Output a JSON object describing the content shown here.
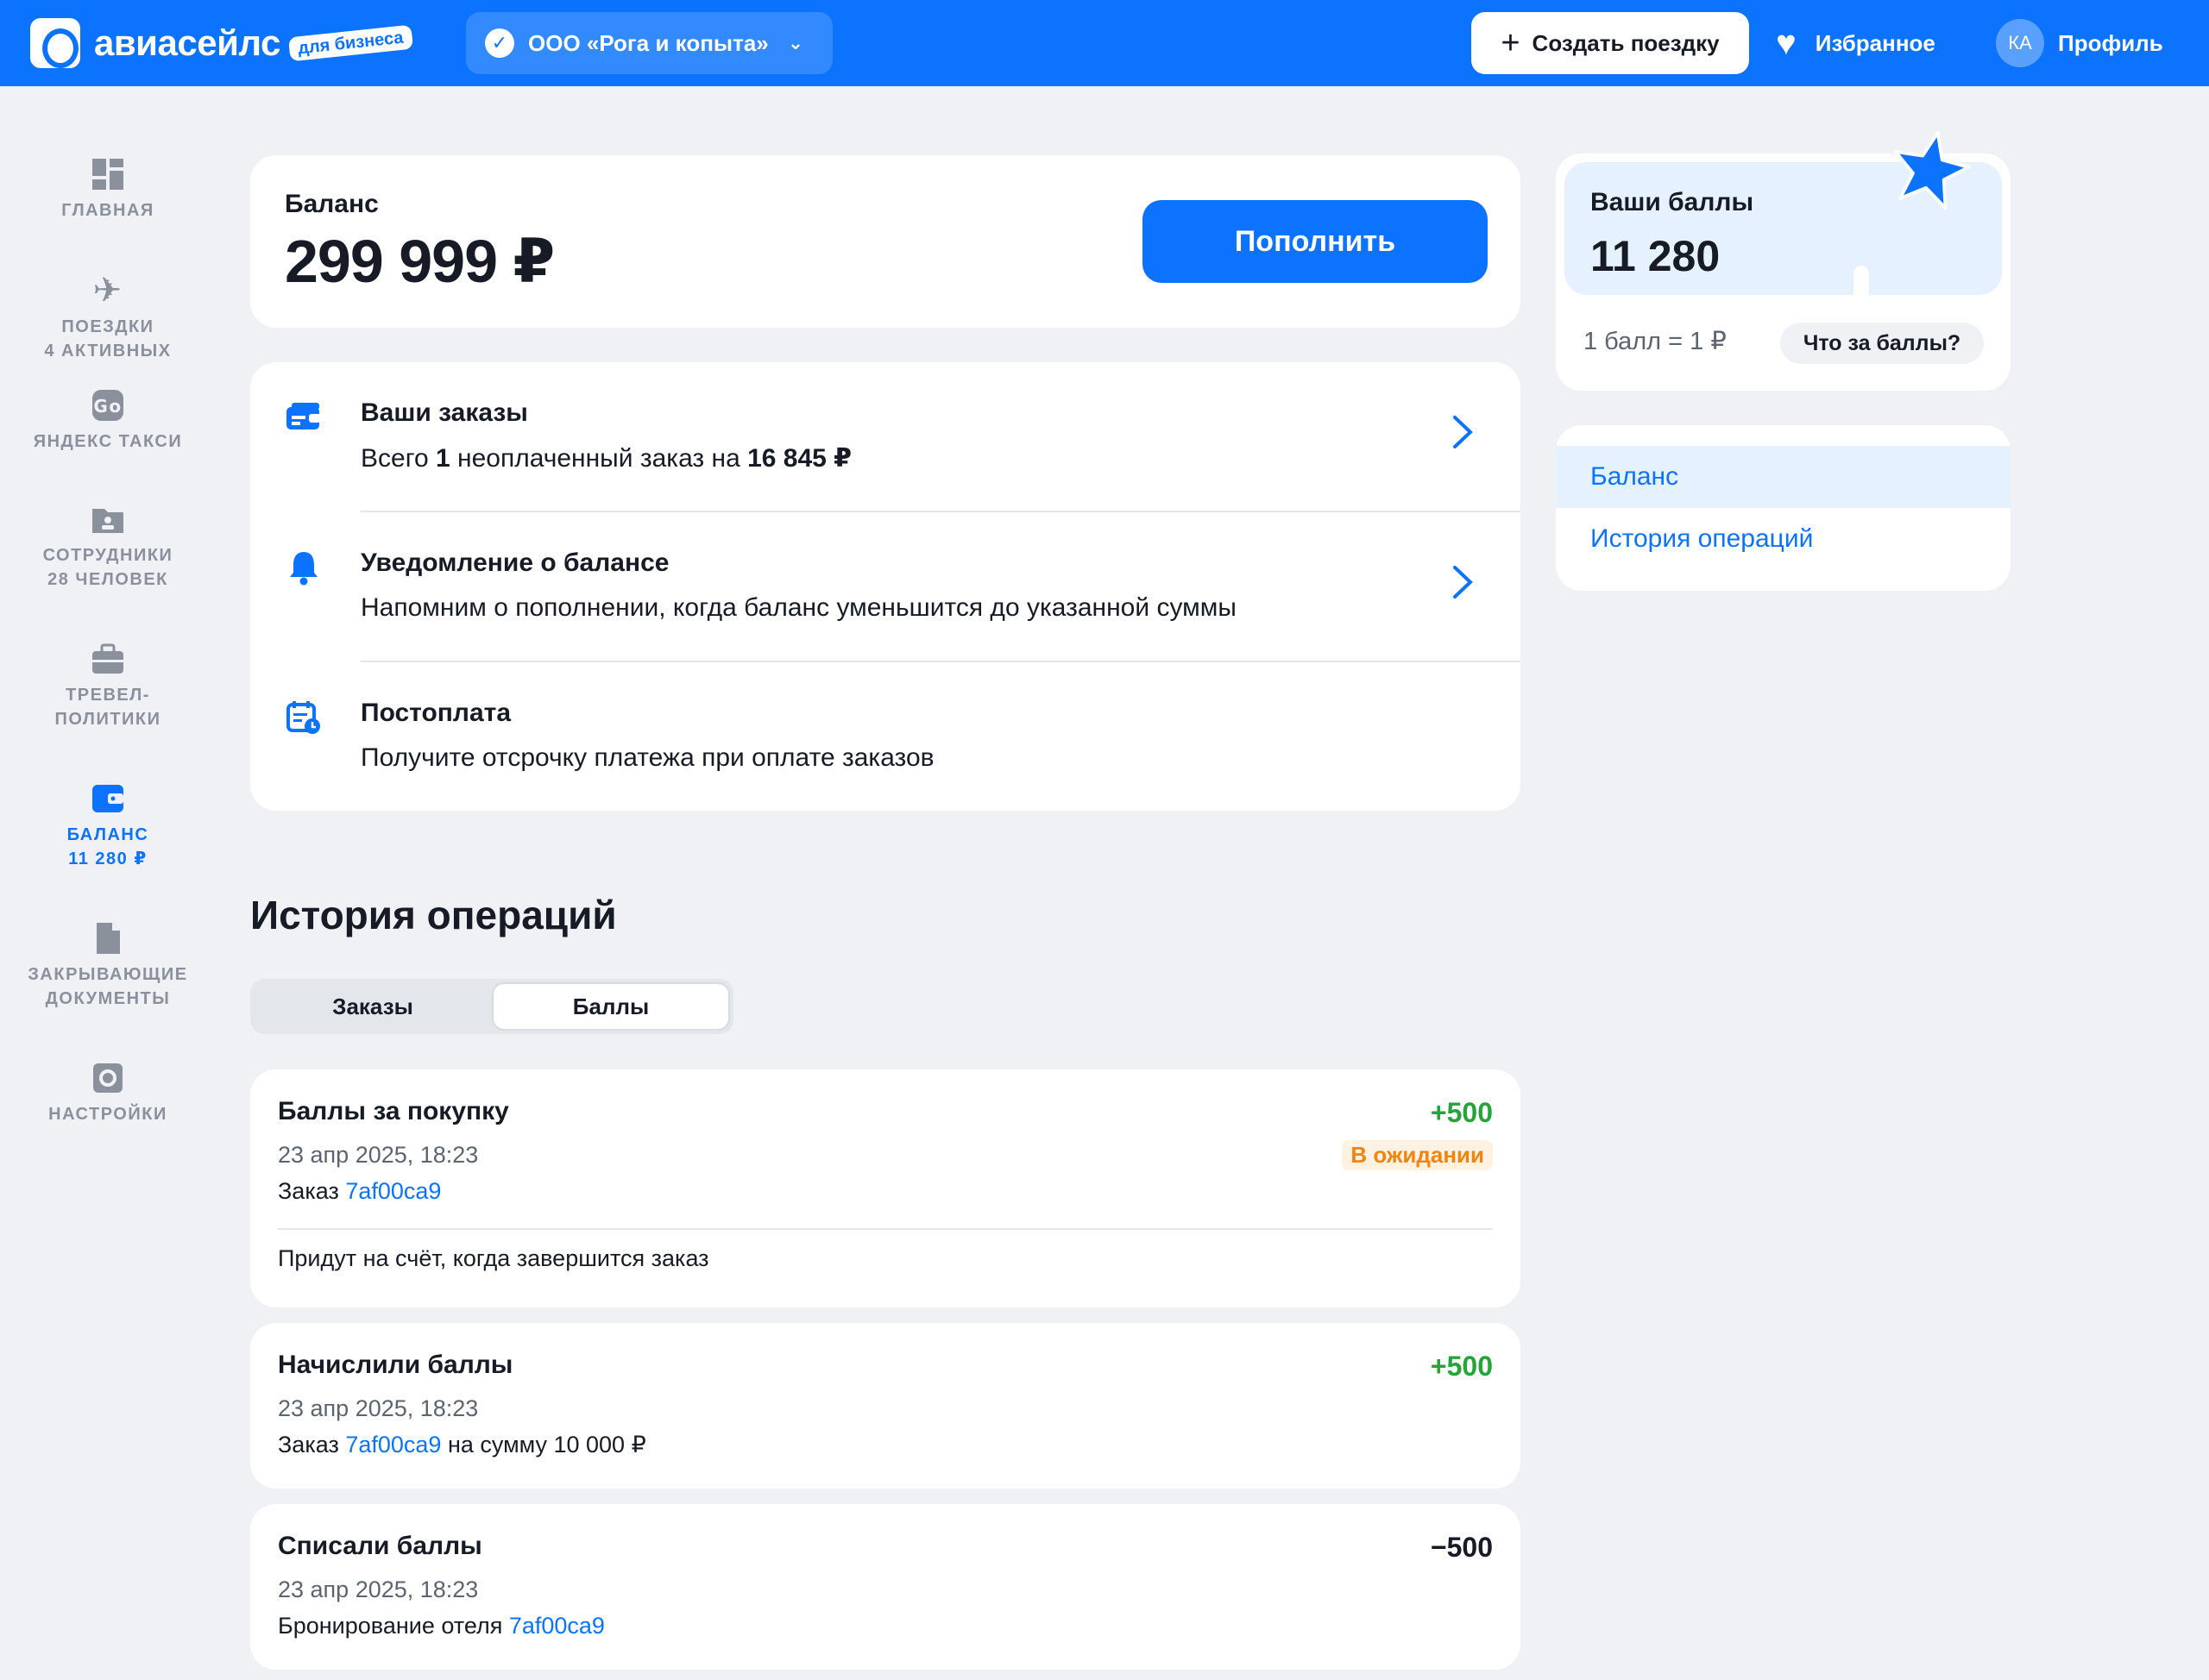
{
  "header": {
    "logo_text": "авиасейлс",
    "logo_badge": "для бизнеса",
    "company": "ООО «Рога и копыта»",
    "create_trip": "Создать поездку",
    "favorites": "Избранное",
    "avatar_initials": "КА",
    "profile": "Профиль",
    "accent_color": "#0c73fe"
  },
  "sidebar": {
    "items": [
      {
        "label": "ГЛАВНАЯ",
        "sub": "",
        "icon": "dashboard-icon"
      },
      {
        "label": "ПОЕЗДКИ",
        "sub": "4 АКТИВНЫХ",
        "icon": "plane-icon"
      },
      {
        "label": "ЯНДЕКС ТАКСИ",
        "sub": "",
        "icon": "taxi-go-icon"
      },
      {
        "label": "СОТРУДНИКИ",
        "sub": "28 ЧЕЛОВЕК",
        "icon": "employees-folder-icon"
      },
      {
        "label": "ТРЕВЕЛ-",
        "sub": "ПОЛИТИКИ",
        "icon": "briefcase-icon"
      },
      {
        "label": "БАЛАНС",
        "sub": "11 280 ₽",
        "icon": "wallet-icon"
      },
      {
        "label": "ЗАКРЫВАЮЩИЕ",
        "sub": "ДОКУМЕНТЫ",
        "icon": "document-icon"
      },
      {
        "label": "НАСТРОЙКИ",
        "sub": "",
        "icon": "settings-icon"
      }
    ]
  },
  "balance": {
    "label": "Баланс",
    "amount": "299 999 ₽",
    "topup": "Пополнить"
  },
  "info_rows": [
    {
      "title": "Ваши заказы",
      "sub_pre": "Всего ",
      "sub_b1": "1",
      "sub_mid": " неоплаченный заказ на ",
      "sub_b2": "16 845 ₽",
      "icon": "orders-card-icon"
    },
    {
      "title": "Уведомление о балансе",
      "sub": "Напомним о пополнении, когда баланс уменьшится до указанной суммы",
      "icon": "bell-icon"
    },
    {
      "title": "Постоплата",
      "sub": "Получите отсрочку платежа при оплате заказов",
      "icon": "postpay-calendar-icon"
    }
  ],
  "history": {
    "title": "История операций",
    "tabs": [
      "Заказы",
      "Баллы"
    ],
    "active_tab": "Баллы",
    "ops": [
      {
        "title": "Баллы за покупку",
        "date": "23 апр 2025, 18:23",
        "order_label": "Заказ ",
        "order_id": "7af00ca9",
        "order_suffix": "",
        "amount": "+500",
        "status": "В ожидании",
        "note": "Придут на счёт, когда завершится заказ"
      },
      {
        "title": "Начислили баллы",
        "date": "23 апр 2025, 18:23",
        "order_label": "Заказ ",
        "order_id": "7af00ca9",
        "order_suffix": " на сумму 10 000 ₽",
        "amount": "+500"
      },
      {
        "title": "Списали баллы",
        "date": "23 апр 2025, 18:23",
        "order_label": "Бронирование отеля ",
        "order_id": "7af00ca9",
        "order_suffix": "",
        "amount": "−500"
      }
    ]
  },
  "points": {
    "label": "Ваши баллы",
    "value": "11 280",
    "rate": "1 балл = 1 ₽",
    "what_btn": "Что за баллы?"
  },
  "side_nav": {
    "items": [
      "Баланс",
      "История операций"
    ],
    "active": "Баланс"
  }
}
